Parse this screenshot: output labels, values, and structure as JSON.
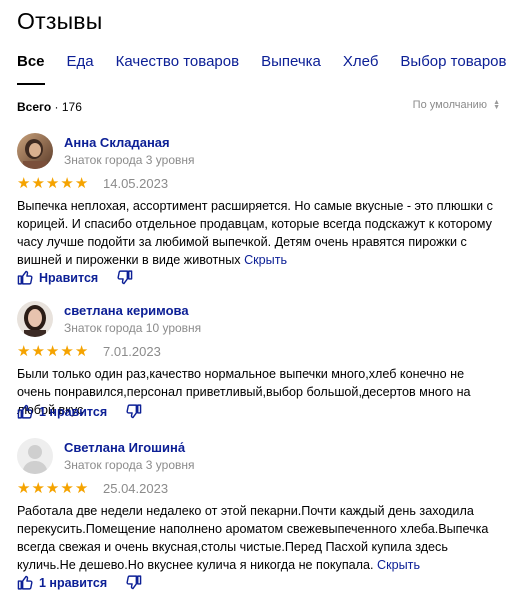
{
  "header": {
    "title": "Отзывы"
  },
  "tabs": [
    {
      "label": "Все",
      "active": true
    },
    {
      "label": "Еда"
    },
    {
      "label": "Качество товаров"
    },
    {
      "label": "Выпечка"
    },
    {
      "label": "Хлеб"
    },
    {
      "label": "Выбор товаров"
    }
  ],
  "summary": {
    "total_label": "Всего",
    "total_sep": " · ",
    "total_count": "176",
    "sort_label": "По умолчанию"
  },
  "colors": {
    "link": "#0d2096",
    "star": "#f5a300",
    "muted": "#8b8b8b"
  },
  "reviews": [
    {
      "author": "Анна Складаная",
      "level": "Знаток города 3 уровня",
      "rating": 5,
      "date": "14.05.2023",
      "text": "Выпечка неплохая, ассортимент расширяется. Но самые вкусные - это плюшки с корицей. И спасибо отдельное продавцам, которые всегда подскажут к которому часу лучше подойти за любимой выпечкой. Детям очень нравятся пирожки с вишней и пироженки в виде животных",
      "hide_label": "Скрыть",
      "like_label": "Нравится",
      "avatar": "photo-avatar"
    },
    {
      "author": "светлана керимова",
      "level": "Знаток города 10 уровня",
      "rating": 5,
      "date": "7.01.2023",
      "text": "Были только один раз,качество нормальное выпечки много,хлеб конечно не очень понравился,персонал приветливый,выбор большой,десертов много на любой вкус.",
      "like_label": "1 нравится",
      "avatar": "photo-avatar"
    },
    {
      "author": "Светлана Игошина́",
      "level": "Знаток города 3 уровня",
      "rating": 5,
      "date": "25.04.2023",
      "text": "Работала две недели недалеко от этой пекарни.Почти каждый день заходила перекусить.Помещение наполнено ароматом свежевыпеченного хлеба.Выпечка всегда свежая и очень вкусная,столы чистые.Перед Пасхой купила здесь куличь.Не дешево.Но вкуснее кулича я никогда не покупала.",
      "hide_label": "Скрыть",
      "like_label": "1 нравится",
      "avatar": "default-avatar"
    }
  ]
}
